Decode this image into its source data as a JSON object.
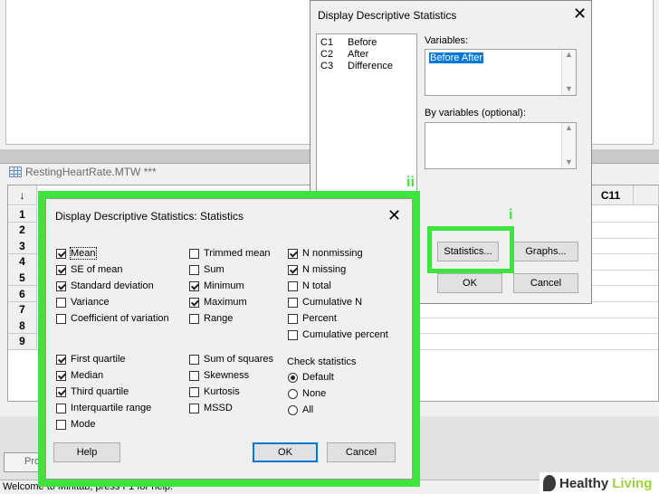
{
  "worksheet": {
    "title": "RestingHeartRate.MTW ***",
    "header_visible": [
      "C11"
    ],
    "row_numbers": [
      "1",
      "2",
      "3",
      "4",
      "5",
      "6",
      "7",
      "8",
      "9"
    ],
    "sort_arrow": "↓"
  },
  "status_bar": "Welcome to Minitab, press F1 for help.",
  "project_tab": "Pro",
  "logo": {
    "text_a": "Healthy",
    "text_b": "Living"
  },
  "main_dialog": {
    "title": "Display Descriptive Statistics",
    "columns": [
      {
        "id": "C1",
        "name": "Before"
      },
      {
        "id": "C2",
        "name": "After"
      },
      {
        "id": "C3",
        "name": "Difference"
      }
    ],
    "variables_label": "Variables:",
    "variables_value": "Before After",
    "by_variables_label": "By variables (optional):",
    "statistics_button": "Statistics...",
    "graphs_button": "Graphs...",
    "ok_button": "OK",
    "cancel_button": "Cancel",
    "step_labels": {
      "a": "ii",
      "b": "i"
    }
  },
  "stats_dialog": {
    "title": "Display Descriptive Statistics: Statistics",
    "col1": [
      {
        "label": "Mean",
        "checked": true
      },
      {
        "label": "SE of mean",
        "checked": true
      },
      {
        "label": "Standard deviation",
        "checked": true
      },
      {
        "label": "Variance",
        "checked": false
      },
      {
        "label": "Coefficient of variation",
        "checked": false
      }
    ],
    "col1b": [
      {
        "label": "First quartile",
        "checked": true
      },
      {
        "label": "Median",
        "checked": true
      },
      {
        "label": "Third quartile",
        "checked": true
      },
      {
        "label": "Interquartile range",
        "checked": false
      },
      {
        "label": "Mode",
        "checked": false
      }
    ],
    "col2": [
      {
        "label": "Trimmed mean",
        "checked": false
      },
      {
        "label": "Sum",
        "checked": false
      },
      {
        "label": "Minimum",
        "checked": true
      },
      {
        "label": "Maximum",
        "checked": true
      },
      {
        "label": "Range",
        "checked": false
      }
    ],
    "col2b": [
      {
        "label": "Sum of squares",
        "checked": false
      },
      {
        "label": "Skewness",
        "checked": false
      },
      {
        "label": "Kurtosis",
        "checked": false
      },
      {
        "label": "MSSD",
        "checked": false
      }
    ],
    "col3": [
      {
        "label": "N nonmissing",
        "checked": true
      },
      {
        "label": "N missing",
        "checked": true
      },
      {
        "label": "N total",
        "checked": false
      },
      {
        "label": "Cumulative N",
        "checked": false
      },
      {
        "label": "Percent",
        "checked": false
      },
      {
        "label": "Cumulative percent",
        "checked": false
      }
    ],
    "check_statistics_label": "Check statistics",
    "check_options": [
      {
        "label": "Default",
        "selected": true
      },
      {
        "label": "None",
        "selected": false
      },
      {
        "label": "All",
        "selected": false
      }
    ],
    "help_button": "Help",
    "ok_button": "OK",
    "cancel_button": "Cancel"
  },
  "colors": {
    "highlight": "#3ce43c",
    "selection": "#0078d7"
  }
}
